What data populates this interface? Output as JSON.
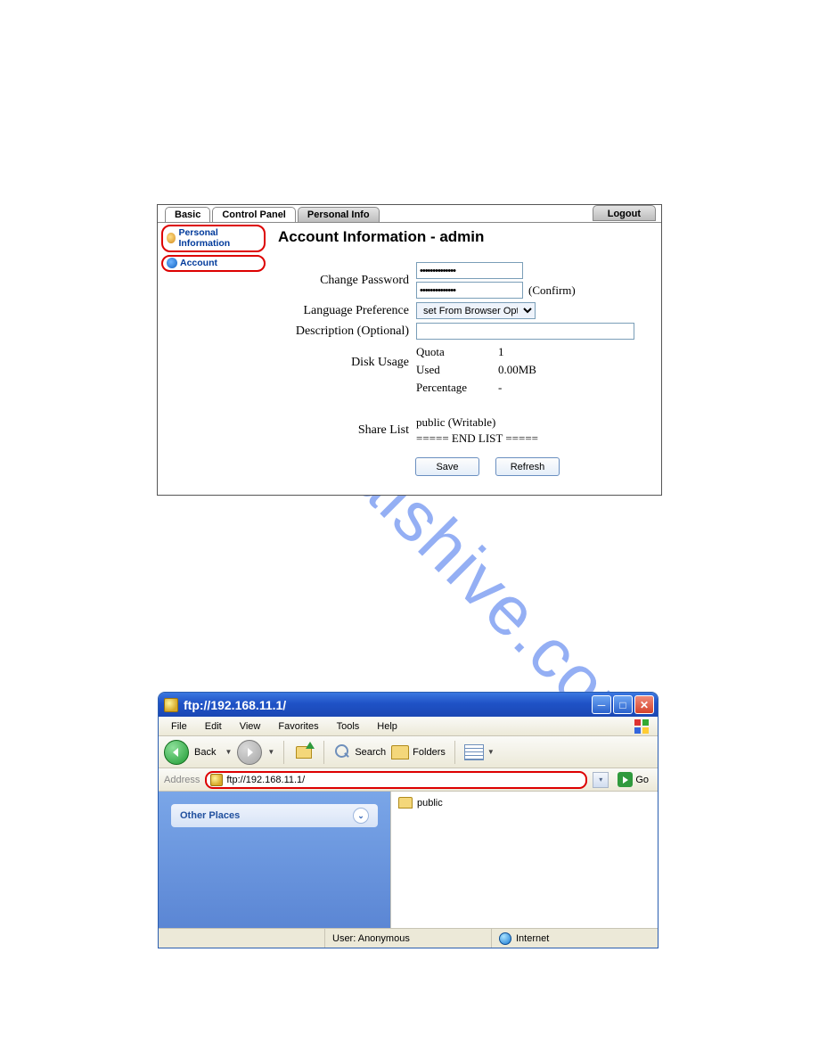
{
  "watermark": "manualshive.com",
  "admin": {
    "tabs": {
      "basic": "Basic",
      "control_panel": "Control Panel",
      "personal_info": "Personal Info"
    },
    "logout": "Logout",
    "sidebar": {
      "personal_info": "Personal Information",
      "account": "Account"
    },
    "title": "Account Information - admin",
    "labels": {
      "change_password": "Change Password",
      "confirm": "(Confirm)",
      "language_pref": "Language Preference",
      "description": "Description (Optional)",
      "disk_usage": "Disk Usage",
      "share_list": "Share List"
    },
    "password_value": "••••••••••••••",
    "language_value": "set From Browser Options",
    "description_value": "",
    "disk": {
      "quota_k": "Quota",
      "quota_v": "1",
      "used_k": "Used",
      "used_v": "0.00MB",
      "pct_k": "Percentage",
      "pct_v": "-"
    },
    "share": {
      "line1": "public (Writable)",
      "line2": "===== END LIST ====="
    },
    "buttons": {
      "save": "Save",
      "refresh": "Refresh"
    }
  },
  "explorer": {
    "title": "ftp://192.168.11.1/",
    "menu": {
      "file": "File",
      "edit": "Edit",
      "view": "View",
      "favorites": "Favorites",
      "tools": "Tools",
      "help": "Help"
    },
    "toolbar": {
      "back": "Back",
      "search": "Search",
      "folders": "Folders"
    },
    "address_label": "Address",
    "address_value": "ftp://192.168.11.1/",
    "go": "Go",
    "left_group": "Other Places",
    "folder_name": "public",
    "status": {
      "user": "User: Anonymous",
      "zone": "Internet"
    }
  }
}
